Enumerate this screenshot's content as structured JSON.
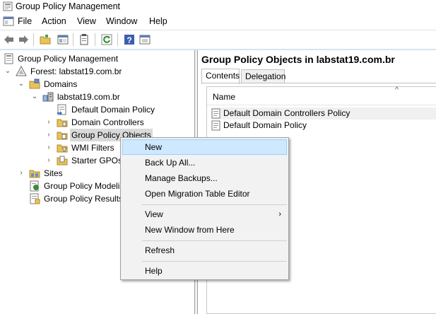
{
  "window": {
    "title": "Group Policy Management"
  },
  "menubar": {
    "items": [
      "File",
      "Action",
      "View",
      "Window",
      "Help"
    ]
  },
  "toolbar": {
    "buttons": [
      "back-icon",
      "forward-icon",
      "folder-icon",
      "show-hide-tree-icon",
      "properties-icon",
      "refresh-icon",
      "help-icon",
      "console-icon"
    ]
  },
  "tree": {
    "root": "Group Policy Management",
    "forest": "Forest: labstat19.com.br",
    "domains": "Domains",
    "domain": "labstat19.com.br",
    "default_policy": "Default Domain Policy",
    "domain_controllers": "Domain Controllers",
    "gpo": "Group Policy Objects",
    "wmi": "WMI Filters",
    "starter": "Starter GPOs",
    "sites": "Sites",
    "modeling": "Group Policy Modeli",
    "results": "Group Policy Results"
  },
  "right": {
    "title": "Group Policy Objects in labstat19.com.br",
    "tabs": [
      "Contents",
      "Delegation"
    ],
    "column": "Name",
    "rows": [
      "Default Domain Controllers Policy",
      "Default Domain Policy"
    ]
  },
  "context_menu": {
    "new": "New",
    "back_up_all": "Back Up All...",
    "manage_backups": "Manage Backups...",
    "open_migration": "Open Migration Table Editor",
    "view": "View",
    "new_window": "New Window from Here",
    "refresh": "Refresh",
    "help": "Help"
  },
  "colors": {
    "highlight": "#cde8ff",
    "highlight_border": "#99d1ff",
    "selection": "#d9d9d9"
  }
}
